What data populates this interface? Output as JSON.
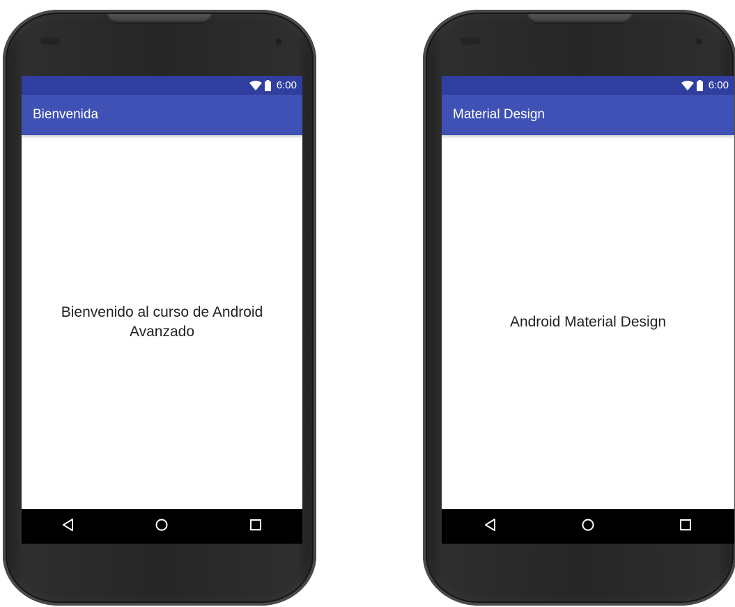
{
  "phones": [
    {
      "status_time": "6:00",
      "app_title": "Bienvenida",
      "content_text": "Bienvenido al curso de Android Avanzado"
    },
    {
      "status_time": "6:00",
      "app_title": "Material Design",
      "content_text": "Android Material Design"
    }
  ],
  "icons": {
    "wifi": "wifi-icon",
    "battery": "battery-icon",
    "back": "back-triangle-icon",
    "home": "home-circle-icon",
    "recents": "recents-square-icon"
  },
  "colors": {
    "status_bar": "#303f9f",
    "app_bar": "#3f51b5",
    "nav_bar": "#000000",
    "device_body": "#262626"
  }
}
